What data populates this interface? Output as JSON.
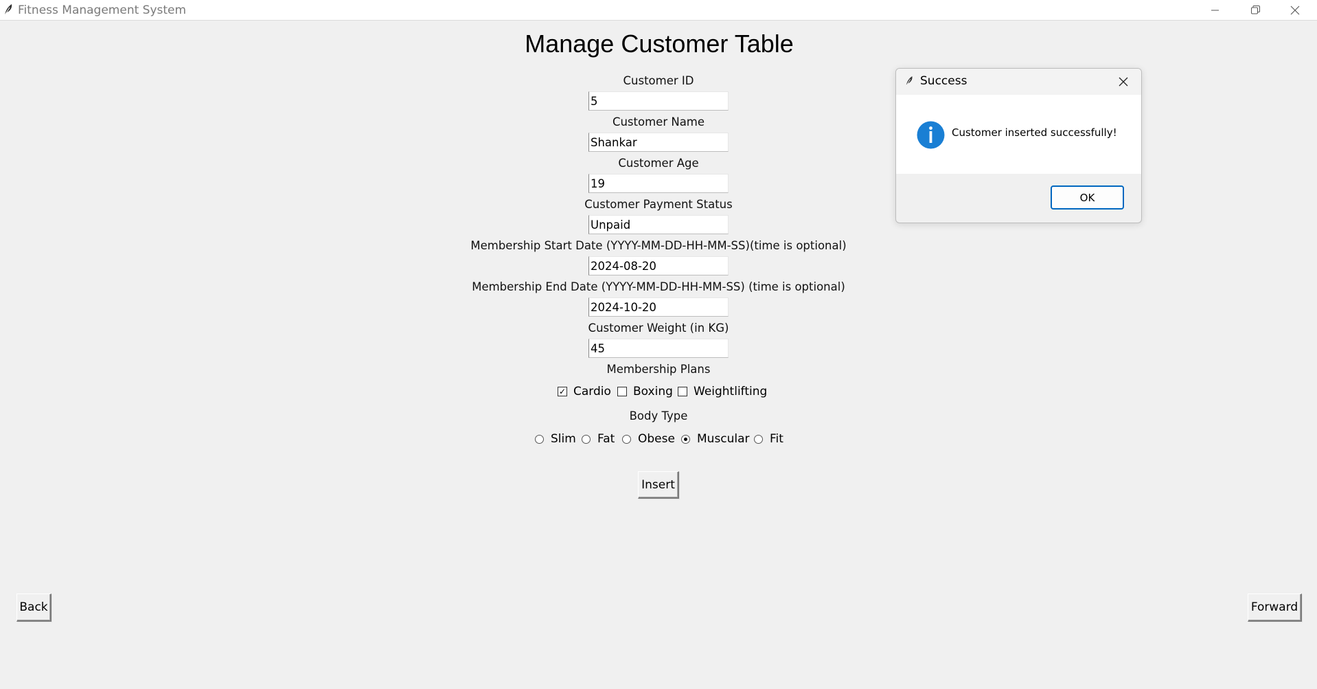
{
  "window": {
    "title": "Fitness Management System",
    "controls": [
      "minimize",
      "restore",
      "close"
    ]
  },
  "form": {
    "title": "Manage Customer Table",
    "fields": [
      {
        "label": "Customer ID",
        "value": "5"
      },
      {
        "label": "Customer Name",
        "value": "Shankar"
      },
      {
        "label": "Customer Age",
        "value": "19"
      },
      {
        "label": "Customer Payment Status",
        "value": "Unpaid"
      },
      {
        "label": "Membership Start Date (YYYY-MM-DD-HH-MM-SS)(time is optional)",
        "value": "2024-08-20"
      },
      {
        "label": "Membership End Date (YYYY-MM-DD-HH-MM-SS) (time is optional)",
        "value": "2024-10-20"
      },
      {
        "label": "Customer Weight (in KG)",
        "value": "45"
      }
    ],
    "membership_plans": {
      "label": "Membership Plans",
      "options": [
        {
          "label": "Cardio",
          "checked": true
        },
        {
          "label": "Boxing",
          "checked": false
        },
        {
          "label": "Weightlifting",
          "checked": false
        }
      ]
    },
    "body_type": {
      "label": "Body Type",
      "options": [
        {
          "label": "Slim",
          "selected": false
        },
        {
          "label": "Fat",
          "selected": false
        },
        {
          "label": "Obese",
          "selected": false
        },
        {
          "label": "Muscular",
          "selected": true
        },
        {
          "label": "Fit",
          "selected": false
        }
      ]
    },
    "insert_label": "Insert"
  },
  "nav": {
    "back_label": "Back",
    "forward_label": "Forward"
  },
  "dialog": {
    "title": "Success",
    "message": "Customer inserted successfully!",
    "ok_label": "OK",
    "icon": "info-icon",
    "accent_color": "#0067c0",
    "icon_color": "#1a7fd4"
  }
}
